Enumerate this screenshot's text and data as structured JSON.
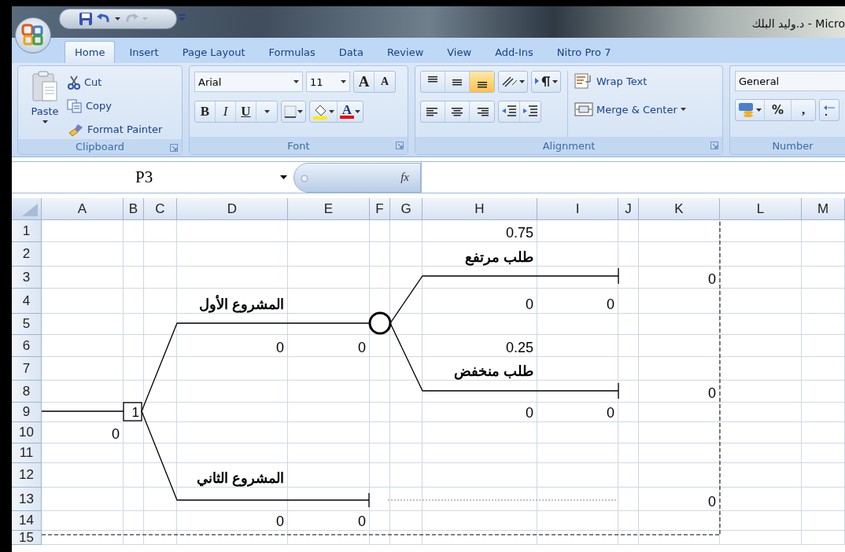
{
  "window": {
    "title": "د.وليد البلك - Micro"
  },
  "tabs": [
    {
      "label": "Home",
      "selected": true
    },
    {
      "label": "Insert",
      "selected": false
    },
    {
      "label": "Page Layout",
      "selected": false
    },
    {
      "label": "Formulas",
      "selected": false
    },
    {
      "label": "Data",
      "selected": false
    },
    {
      "label": "Review",
      "selected": false
    },
    {
      "label": "View",
      "selected": false
    },
    {
      "label": "Add-Ins",
      "selected": false
    },
    {
      "label": "Nitro Pro 7",
      "selected": false
    }
  ],
  "ribbon": {
    "clipboard": {
      "title": "Clipboard",
      "paste": "Paste",
      "commands": [
        {
          "kind": "cut",
          "label": "Cut"
        },
        {
          "kind": "copy",
          "label": "Copy"
        },
        {
          "kind": "painter",
          "label": "Format Painter"
        }
      ]
    },
    "font": {
      "title": "Font",
      "name": "Arial",
      "size": "11",
      "grow": "A",
      "shrink": "A",
      "bold": "B",
      "italic": "I",
      "underline": "U",
      "font_color": "A"
    },
    "alignment": {
      "title": "Alignment",
      "vertical": [
        {
          "kind": "top",
          "selected": false
        },
        {
          "kind": "middle",
          "selected": false
        },
        {
          "kind": "bottom",
          "selected": true
        }
      ],
      "horizontal": [
        {
          "kind": "left",
          "selected": false
        },
        {
          "kind": "center",
          "selected": false
        },
        {
          "kind": "right",
          "selected": false
        }
      ],
      "wrap_text": "Wrap Text",
      "merge": "Merge & Center"
    },
    "number": {
      "title": "Number",
      "format": "General",
      "percent": "%",
      "comma": ","
    }
  },
  "formula_bar": {
    "name_box": "P3",
    "fx": "fx"
  },
  "sheet": {
    "columns": [
      "A",
      "B",
      "C",
      "D",
      "E",
      "F",
      "G",
      "H",
      "I",
      "J",
      "K",
      "L",
      "M"
    ],
    "rows": [
      {
        "header": "1",
        "cells": {
          "H": {
            "text": "0.75",
            "bold": false
          }
        }
      },
      {
        "header": "2",
        "cells": {
          "H": {
            "text": "طلب مرتفع",
            "bold": true
          }
        }
      },
      {
        "header": "3",
        "cells": {
          "K": {
            "text": "0",
            "bold": false
          }
        }
      },
      {
        "header": "4",
        "cells": {
          "D": {
            "text": "المشروع الأول",
            "bold": true
          },
          "H": {
            "text": "0",
            "bold": false
          },
          "I": {
            "text": "0",
            "bold": false
          }
        }
      },
      {
        "header": "5",
        "cells": {}
      },
      {
        "header": "6",
        "cells": {
          "D": {
            "text": "0",
            "bold": false
          },
          "E": {
            "text": "0",
            "bold": false
          },
          "H": {
            "text": "0.25",
            "bold": false
          }
        }
      },
      {
        "header": "7",
        "cells": {
          "H": {
            "text": "طلب منخفض",
            "bold": true
          }
        }
      },
      {
        "header": "8",
        "cells": {
          "K": {
            "text": "0",
            "bold": false
          }
        }
      },
      {
        "header": "9",
        "cells": {
          "H": {
            "text": "0",
            "bold": false
          },
          "I": {
            "text": "0",
            "bold": false
          }
        }
      },
      {
        "header": "10",
        "cells": {
          "A": {
            "text": "0",
            "bold": false
          }
        }
      },
      {
        "header": "11",
        "cells": {}
      },
      {
        "header": "12",
        "cells": {
          "D": {
            "text": "المشروع الثاني",
            "bold": true
          }
        }
      },
      {
        "header": "13",
        "cells": {
          "K": {
            "text": "0",
            "bold": false
          }
        }
      },
      {
        "header": "14",
        "cells": {
          "D": {
            "text": "0",
            "bold": false
          },
          "E": {
            "text": "0",
            "bold": false
          }
        }
      },
      {
        "header": "15",
        "cells": {}
      }
    ],
    "decision_node": {
      "label": "1"
    }
  }
}
